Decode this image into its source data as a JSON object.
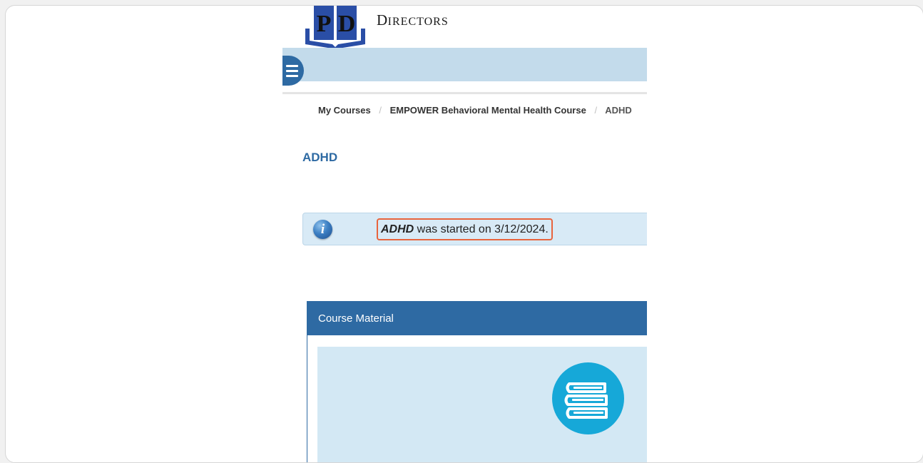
{
  "brand": {
    "logo_letters": "PD",
    "name_first": "D",
    "name_rest": "IRECTORS"
  },
  "breadcrumb": {
    "items": [
      "My Courses",
      "EMPOWER Behavioral Mental Health Course"
    ],
    "current": "ADHD",
    "separator": "/"
  },
  "page": {
    "title": "ADHD"
  },
  "alert": {
    "course_name": "ADHD",
    "message": " was started on 3/12/2024."
  },
  "course_material": {
    "header": "Course Material"
  },
  "colors": {
    "primary": "#2e6aa3",
    "navbar": "#c3dbeb",
    "alert_bg": "#d8eaf6",
    "highlight": "#e8643d",
    "badge": "#16a8d8"
  }
}
